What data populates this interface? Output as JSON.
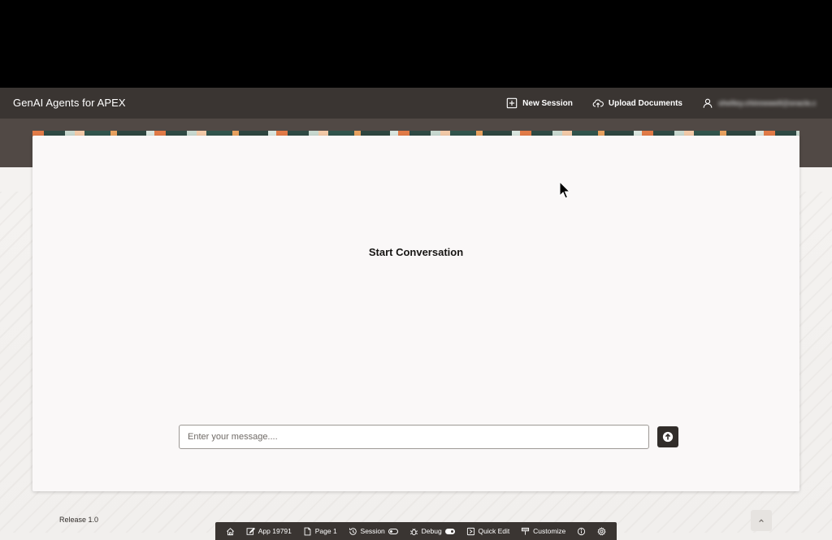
{
  "header": {
    "app_title": "GenAI Agents for APEX",
    "new_session_label": "New Session",
    "upload_label": "Upload Documents",
    "user_email": "shelley.chinnewell@oracle.com"
  },
  "main": {
    "conversation_title": "Start Conversation",
    "message_placeholder": "Enter your message...."
  },
  "footer": {
    "release": "Release 1.0"
  },
  "dev_toolbar": {
    "app": "App 19791",
    "page": "Page 1",
    "session": "Session",
    "debug": "Debug",
    "quick_edit": "Quick Edit",
    "customize": "Customize"
  },
  "colors": {
    "header_bg": "#3a3532",
    "accent_dark": "#312d2a",
    "card_bg": "#faf8f8"
  },
  "icons": [
    "plus-square-icon",
    "cloud-upload-icon",
    "user-icon",
    "arrow-up-circle-icon",
    "home-icon",
    "edit-icon",
    "page-icon",
    "history-icon",
    "bug-icon",
    "quick-edit-icon",
    "brush-icon",
    "info-icon",
    "gear-icon",
    "chevron-up-icon"
  ]
}
